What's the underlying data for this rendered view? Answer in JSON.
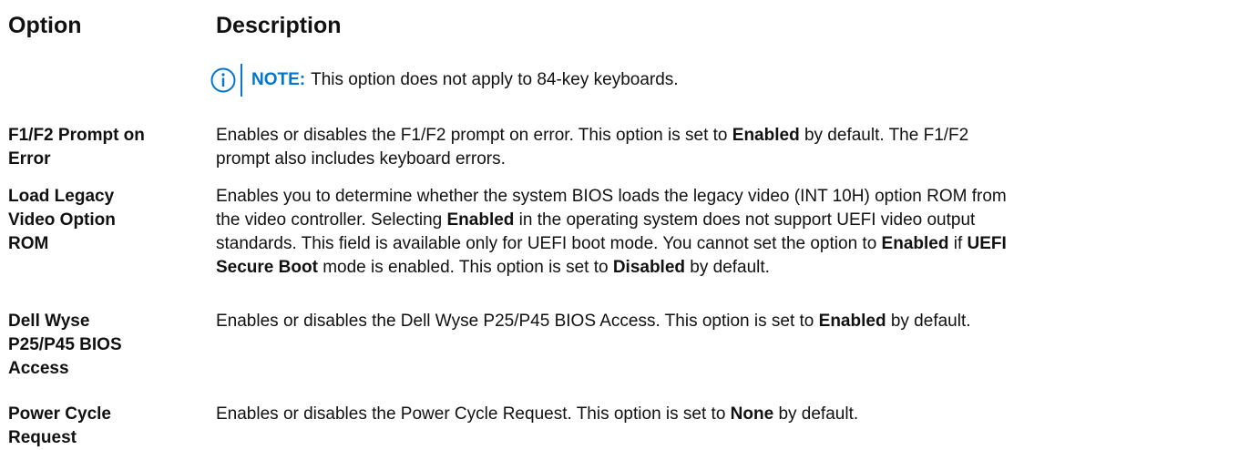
{
  "header": {
    "option": "Option",
    "description": "Description"
  },
  "note": {
    "icon": "info-icon",
    "label": "NOTE:",
    "text": "This option does not apply to 84-key keyboards."
  },
  "rows": [
    {
      "option_line1": "F1/F2 Prompt on",
      "option_line2": "Error",
      "option_line3": "",
      "desc": [
        [
          "Enables or disables the F1/F2 prompt on error. This option is set to ",
          "Enabled",
          " by default. The F1/F2"
        ],
        [
          "prompt also includes keyboard errors."
        ]
      ]
    },
    {
      "option_line1": "Load Legacy",
      "option_line2": "Video Option",
      "option_line3": "ROM",
      "desc": [
        [
          "Enables you to determine whether the system BIOS loads the legacy video (INT 10H) option ROM from"
        ],
        [
          "the video controller. Selecting ",
          "Enabled",
          " in the operating system does not support UEFI video output"
        ],
        [
          "standards. This field is available only for UEFI boot mode. You cannot set the option to ",
          "Enabled",
          " if ",
          "UEFI"
        ],
        [
          "Secure Boot",
          " mode is enabled. This option is set to ",
          "Disabled",
          " by default."
        ]
      ]
    },
    {
      "option_line1": "Dell Wyse",
      "option_line2": "P25/P45 BIOS",
      "option_line3": "Access",
      "desc": [
        [
          "Enables or disables the Dell Wyse P25/P45 BIOS Access. This option is set to ",
          "Enabled",
          " by default."
        ]
      ]
    },
    {
      "option_line1": "Power Cycle",
      "option_line2": "Request",
      "option_line3": "",
      "desc": [
        [
          "Enables or disables the Power Cycle Request. This option is set to ",
          "None",
          " by default."
        ]
      ]
    }
  ],
  "colors": {
    "accent": "#0076ce",
    "text": "#111111"
  }
}
